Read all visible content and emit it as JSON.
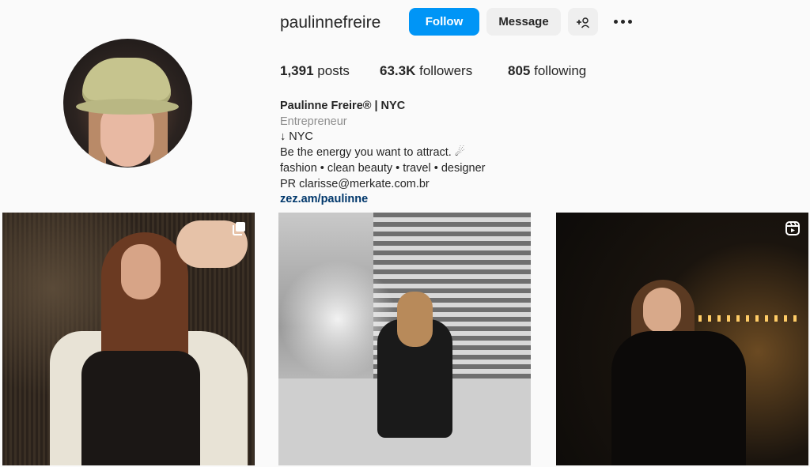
{
  "profile": {
    "username": "paulinnefreire",
    "buttons": {
      "follow": "Follow",
      "message": "Message"
    },
    "stats": {
      "posts_count": "1,391",
      "posts_label": "posts",
      "followers_count": "63.3K",
      "followers_label": "followers",
      "following_count": "805",
      "following_label": "following"
    },
    "bio": {
      "name": "Paulinne Freire® | NYC",
      "category": "Entrepreneur",
      "lines": [
        "↓ NYC",
        "Be the energy you want to attract. ☄",
        "fashion • clean beauty • travel • designer",
        "PR clarisse@merkate.com.br"
      ],
      "link": "zez.am/paulinne"
    }
  },
  "posts": [
    {
      "type": "carousel",
      "icon": "carousel-icon"
    },
    {
      "type": "photo"
    },
    {
      "type": "reel",
      "icon": "reel-icon"
    }
  ],
  "colors": {
    "accent": "#0095f6",
    "link": "#00376b",
    "muted": "#8e8e8e",
    "background": "#fafafa"
  }
}
